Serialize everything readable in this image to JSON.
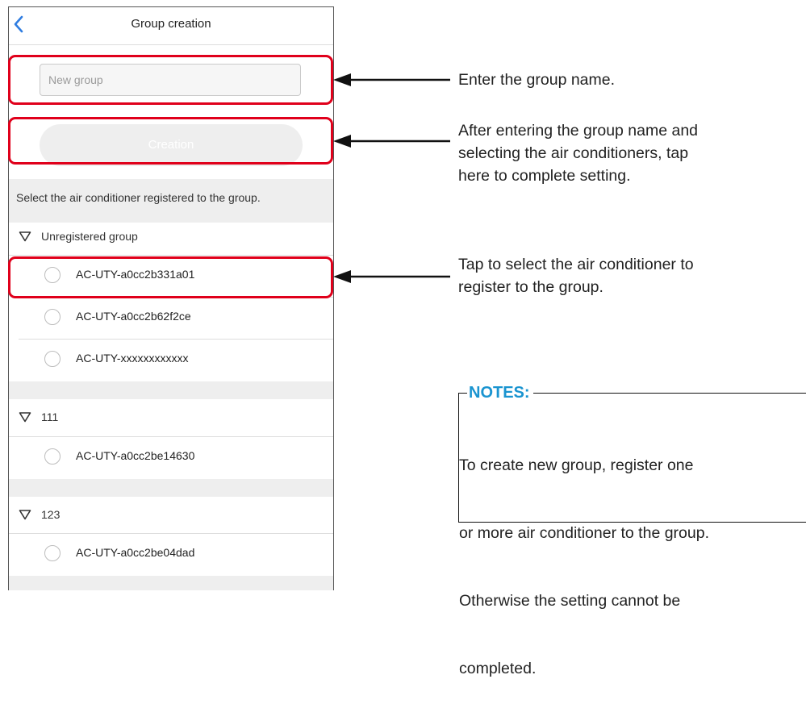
{
  "app": {
    "nav_title": "Group creation",
    "back_icon": "chevron-left-icon"
  },
  "form": {
    "group_name_placeholder": "New group",
    "group_name_value": "",
    "creation_label": "Creation"
  },
  "instruction": "Select the air conditioner registered to the group.",
  "groups": [
    {
      "name": "Unregistered group",
      "devices": [
        "AC-UTY-a0cc2b331a01",
        "AC-UTY-a0cc2b62f2ce",
        "AC-UTY-xxxxxxxxxxxx"
      ]
    },
    {
      "name": "111",
      "devices": [
        "AC-UTY-a0cc2be14630"
      ]
    },
    {
      "name": "123",
      "devices": [
        "AC-UTY-a0cc2be04dad"
      ]
    }
  ],
  "callouts": {
    "name": "Enter the group name.",
    "creation": [
      "After entering the group name and",
      "selecting the air conditioners, tap",
      "here to complete setting."
    ],
    "select": [
      "Tap to select the air conditioner to",
      "register to the group."
    ]
  },
  "notes": {
    "title": "NOTES:",
    "lines": [
      "To create new group, register one",
      "or more air conditioner to the group.",
      "Otherwise the setting cannot be",
      "completed."
    ]
  },
  "colors": {
    "highlight": "#e0001b",
    "back_chevron": "#2f7de1",
    "notes_title": "#1a94d0",
    "section_band": "#eeeeee"
  }
}
